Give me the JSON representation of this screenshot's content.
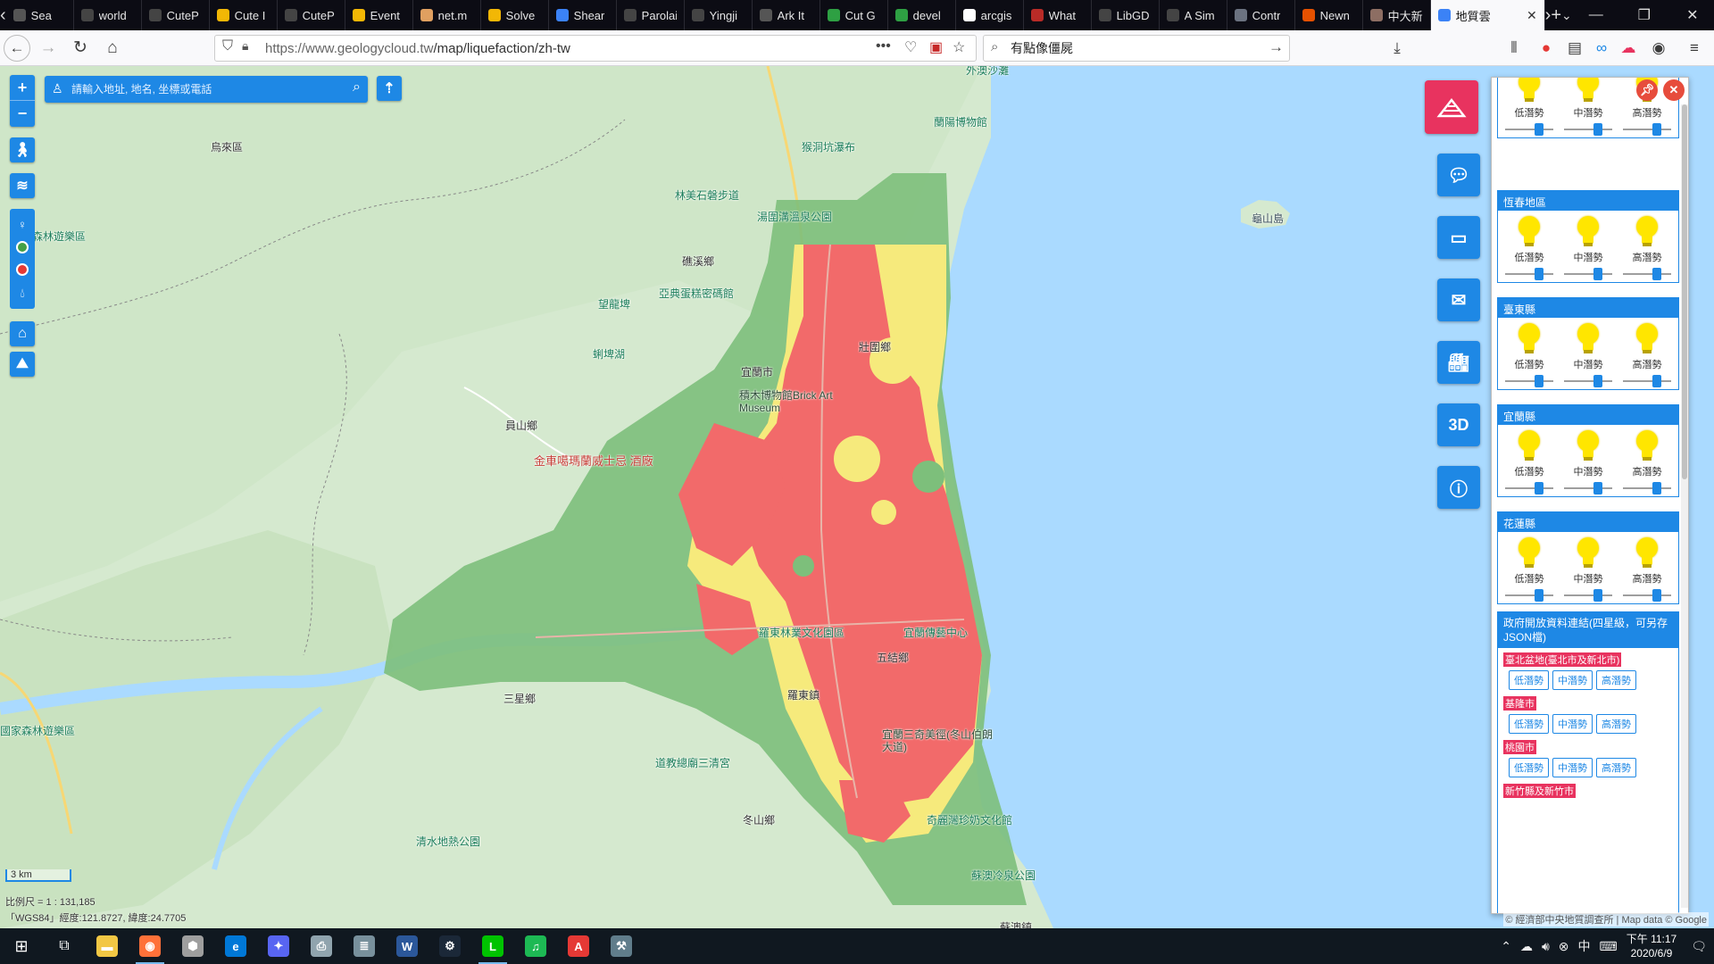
{
  "browser": {
    "tabs": [
      {
        "label": "Sea",
        "color": "#555555"
      },
      {
        "label": "world",
        "color": "#444444"
      },
      {
        "label": "CuteP",
        "color": "#444444"
      },
      {
        "label": "Cute I",
        "color": "#f2b705"
      },
      {
        "label": "CuteP",
        "color": "#444444"
      },
      {
        "label": "Event",
        "color": "#f2b705"
      },
      {
        "label": "net.m",
        "color": "#e0a060"
      },
      {
        "label": "Solve",
        "color": "#f2b705"
      },
      {
        "label": "Shear",
        "color": "#3b82f6"
      },
      {
        "label": "Parolai et",
        "color": "#444444"
      },
      {
        "label": "Yingji",
        "color": "#444444"
      },
      {
        "label": "Ark It",
        "color": "#555555"
      },
      {
        "label": "Cut G",
        "color": "#2ea043"
      },
      {
        "label": "devel",
        "color": "#2ea043"
      },
      {
        "label": "arcgis",
        "color": "#ffffff"
      },
      {
        "label": "What",
        "color": "#b92b27"
      },
      {
        "label": "LibGD",
        "color": "#444444"
      },
      {
        "label": "A Sim",
        "color": "#444444"
      },
      {
        "label": "Contr",
        "color": "#6b7280"
      },
      {
        "label": "Newn",
        "color": "#e65100"
      },
      {
        "label": "中大新",
        "color": "#8d6e63"
      },
      {
        "label": "地質雲",
        "color": "#3b82f6",
        "active": true
      }
    ],
    "url_host": "https://www.geologycloud.tw",
    "url_path": "/map/liquefaction/zh-tw",
    "search_value": "有點像僵屍",
    "toolbar_icons": [
      "page-actions-icon",
      "pocket-icon",
      "extension-icon",
      "bookmark-star-icon"
    ]
  },
  "map": {
    "search_placeholder": "請輸入地址, 地名, 坐標或電話",
    "scale_label": "3 km",
    "scale_ratio": "比例尺 = 1 : 131,185",
    "coords": "「WGS84」經度:121.8727, 緯度:24.7705",
    "attribution": "© 經濟部中央地質調查所 | Map data © Google",
    "labels": {
      "waiao": "外澳沙灘",
      "lanyang": "蘭陽博物館",
      "houdong": "猴洞坑瀑布",
      "tangwei": "湯圍溝溫泉公園",
      "linmei": "林美石磐步道",
      "jiaoxi": "礁溪鄉",
      "asia_cement": "亞典蛋糕密碼館",
      "wanglong": "望龍埤",
      "meipu": "蜊埤湖",
      "yilan_city": "宜蘭市",
      "brick": "積木博物館Brick Art Museum",
      "zhuangwei": "壯圍鄉",
      "yuanshan": "員山鄉",
      "jinche": "金車噶瑪蘭威士忌 酒廠",
      "luodong_forest": "羅東林業文化園區",
      "chuanyi": "宜蘭傳藝中心",
      "wujie": "五結鄉",
      "luodong": "羅東鎮",
      "sanxing": "三星鄉",
      "dongshan_temple": "道教總廟三清宮",
      "zhuangwei2": "宜蘭三奇美徑(冬山伯朗大道)",
      "dongshan": "冬山鄉",
      "qilan": "奇麗灣珍奶文化館",
      "qingshui": "清水地熱公園",
      "suao_cold": "蘇澳冷泉公園",
      "suao": "蘇澳鎮",
      "wulai": "烏來區",
      "forest_rec": "森林遊樂區",
      "national_forest": "國家森林遊樂區",
      "guishan": "龜山島",
      "dongshan_town": "冬山鄉"
    },
    "right_buttons": [
      "chat-icon",
      "screen-icon",
      "mail-icon",
      "factory-icon",
      "3D",
      "info-icon"
    ]
  },
  "legend": {
    "levels": [
      "低潛勢",
      "中潛勢",
      "高潛勢"
    ],
    "sections": [
      {
        "title": "",
        "values": [
          0.75,
          0.75,
          0.75
        ]
      },
      {
        "title": "恆春地區",
        "values": [
          0.75,
          0.75,
          0.75
        ]
      },
      {
        "title": "臺東縣",
        "values": [
          0.75,
          0.75,
          0.75
        ]
      },
      {
        "title": "宜蘭縣",
        "values": [
          0.75,
          0.75,
          0.75
        ]
      },
      {
        "title": "花蓮縣",
        "values": [
          0.75,
          0.75,
          0.75
        ]
      }
    ],
    "opendata_title": "政府開放資料連結(四星級，可另存JSON檔)",
    "opendata_groups": [
      {
        "title": "臺北盆地(臺北市及新北市)",
        "buttons": [
          "低潛勢",
          "中潛勢",
          "高潛勢"
        ]
      },
      {
        "title": "基隆市",
        "buttons": [
          "低潛勢",
          "中潛勢",
          "高潛勢"
        ]
      },
      {
        "title": "桃園市",
        "buttons": [
          "低潛勢",
          "中潛勢",
          "高潛勢"
        ]
      },
      {
        "title": "新竹縣及新竹市",
        "buttons": []
      }
    ]
  },
  "taskbar": {
    "apps": [
      {
        "name": "file-explorer-icon",
        "color": "#f2c744",
        "open": false
      },
      {
        "name": "firefox-icon",
        "color": "#ff7139",
        "open": true
      },
      {
        "name": "box-app-icon",
        "color": "#9e9e9e",
        "open": false
      },
      {
        "name": "edge-icon",
        "color": "#0078d7",
        "open": false
      },
      {
        "name": "chat-app-icon",
        "color": "#5865f2",
        "open": false
      },
      {
        "name": "scanner-icon",
        "color": "#90a4ae",
        "open": false
      },
      {
        "name": "database-icon",
        "color": "#78909c",
        "open": false
      },
      {
        "name": "word-icon",
        "color": "#2b579a",
        "open": false
      },
      {
        "name": "steam-icon",
        "color": "#1b2838",
        "open": false
      },
      {
        "name": "line-icon",
        "color": "#00c300",
        "open": true
      },
      {
        "name": "spotify-icon",
        "color": "#1db954",
        "open": false
      },
      {
        "name": "pdf-icon",
        "color": "#e53935",
        "open": false
      },
      {
        "name": "tools-icon",
        "color": "#607d8b",
        "open": false
      }
    ],
    "time": "下午 11:17",
    "date": "2020/6/9"
  }
}
